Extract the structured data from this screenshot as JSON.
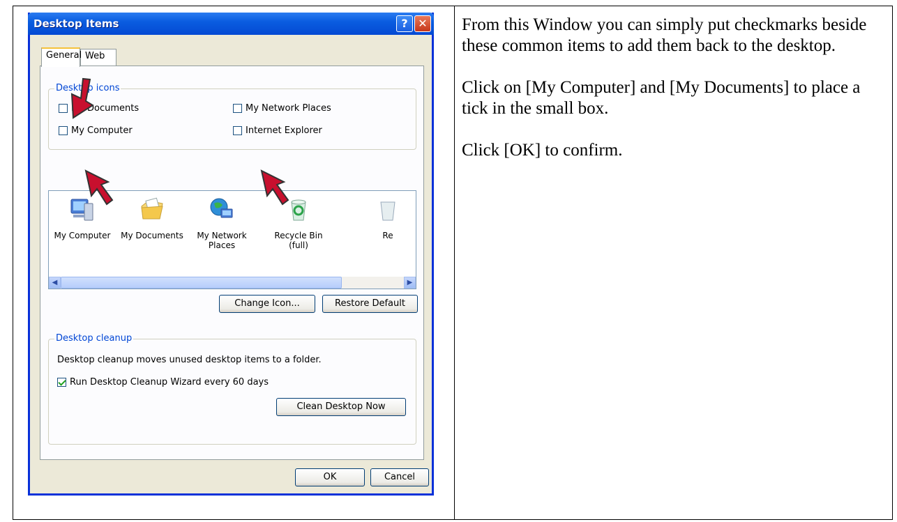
{
  "dialog": {
    "title": "Desktop Items",
    "tabs": [
      {
        "label": "General"
      },
      {
        "label": "Web"
      }
    ],
    "desktop_icons_group": {
      "legend": "Desktop icons",
      "checkboxes": [
        {
          "label": "My Documents",
          "checked": false
        },
        {
          "label": "My Network Places",
          "checked": false
        },
        {
          "label": "My Computer",
          "checked": false
        },
        {
          "label": "Internet Explorer",
          "checked": false
        }
      ]
    },
    "icon_list": [
      {
        "label": "My Computer",
        "icon": "computer-icon"
      },
      {
        "label": "My Documents",
        "icon": "folder-documents-icon"
      },
      {
        "label": "My Network Places",
        "icon": "network-places-icon"
      },
      {
        "label": "Recycle Bin (full)",
        "icon": "recycle-bin-icon"
      },
      {
        "label": "Re",
        "icon": "recycle-bin-icon"
      }
    ],
    "change_icon_label": "Change Icon...",
    "restore_default_label": "Restore Default",
    "cleanup_group": {
      "legend": "Desktop cleanup",
      "description": "Desktop cleanup moves unused desktop items to a folder.",
      "wizard_checkbox": {
        "label": "Run Desktop Cleanup Wizard every 60 days",
        "checked": true
      },
      "clean_now_label": "Clean Desktop Now"
    },
    "ok_label": "OK",
    "cancel_label": "Cancel"
  },
  "instructions": [
    "From this Window you can simply put checkmarks beside these common items to add them back to the desktop.",
    "Click on [My Computer] and [My Documents] to place a tick in the small box.",
    "Click [OK] to confirm."
  ],
  "colors": {
    "titlebar": "#0a5de0",
    "legend": "#0046d5",
    "arrow": "#c8102e"
  }
}
